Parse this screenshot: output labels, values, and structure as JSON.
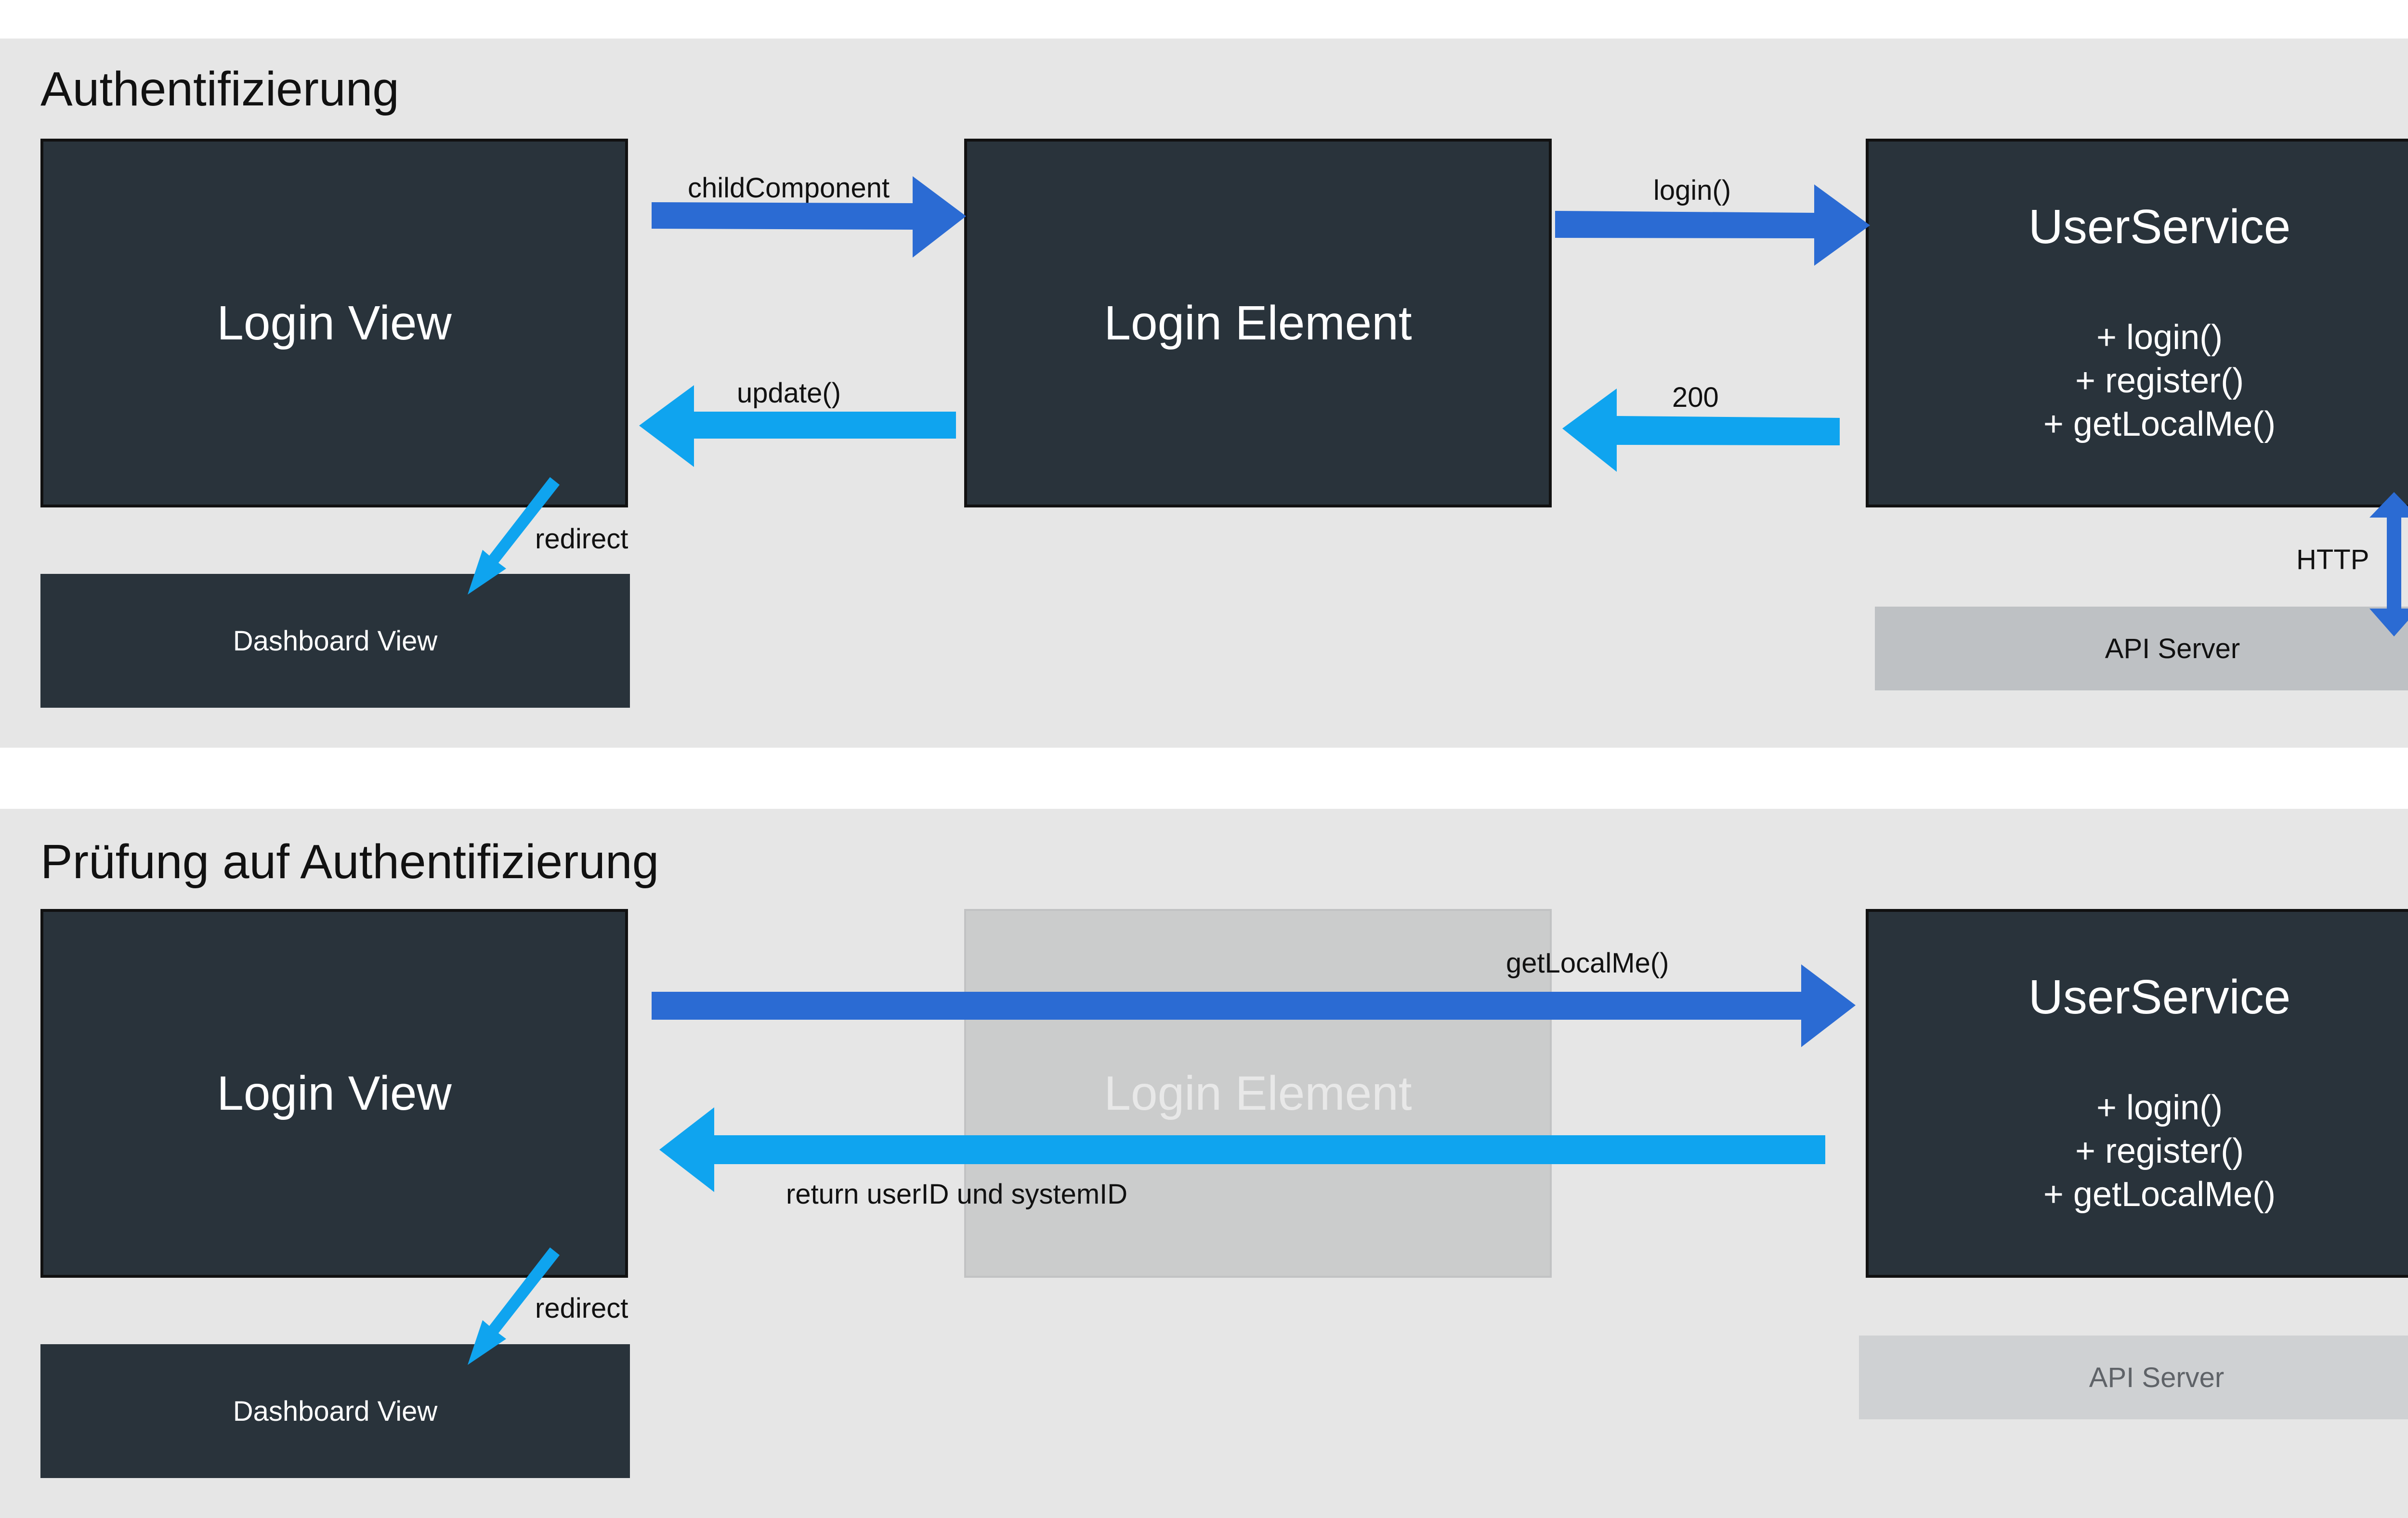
{
  "sections": [
    {
      "title": "Authentifizierung",
      "login_view": "Login View",
      "login_element": "Login Element",
      "user_service": {
        "title": "UserService",
        "methods": [
          "+ login()",
          "+ register()",
          "+ getLocalMe()"
        ]
      },
      "dashboard_view": "Dashboard View",
      "api_server": "API Server",
      "arrows": {
        "child_component": "childComponent",
        "login": "login()",
        "update": "update()",
        "status_200": "200",
        "redirect": "redirect",
        "http": "HTTP"
      }
    },
    {
      "title": "Prüfung auf Authentifizierung",
      "login_view": "Login View",
      "login_element": "Login Element",
      "user_service": {
        "title": "UserService",
        "methods": [
          "+ login()",
          "+ register()",
          "+ getLocalMe()"
        ]
      },
      "dashboard_view": "Dashboard View",
      "api_server": "API Server",
      "arrows": {
        "get_local_me": "getLocalMe()",
        "return_ids": "return userID und systemID",
        "redirect": "redirect"
      }
    }
  ],
  "colors": {
    "request_arrow": "#2b6bd3",
    "response_arrow": "#0fa4ef",
    "box_fill": "#29333b",
    "panel_background": "#e6e6e6"
  }
}
